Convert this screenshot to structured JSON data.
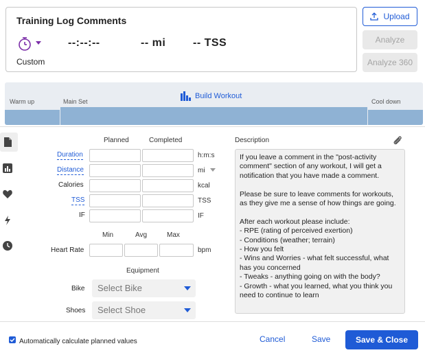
{
  "summary": {
    "title": "Training Log Comments",
    "workout_type": "Custom",
    "duration": "--:--:--",
    "distance": "-- mi",
    "tss": "-- TSS",
    "icon": "stopwatch-icon",
    "accent": "#7b2ea8"
  },
  "actions": {
    "upload_label": "Upload",
    "analyze_label": "Analyze",
    "analyze360_label": "Analyze 360"
  },
  "builder": {
    "build_label": "Build Workout",
    "segments": [
      "Warm up",
      "Main Set",
      "Cool down"
    ],
    "bar_color": "#8fb2d4"
  },
  "rail": {
    "icons": [
      "document-icon",
      "chart-icon",
      "heart-icon",
      "bolt-icon",
      "clock-icon"
    ]
  },
  "planned_completed": {
    "headers": [
      "Planned",
      "Completed"
    ],
    "rows": [
      {
        "label": "Duration",
        "unit": "h:m:s",
        "planned": "",
        "completed": ""
      },
      {
        "label": "Distance",
        "unit": "mi",
        "planned": "",
        "completed": ""
      },
      {
        "label": "Calories",
        "unit": "kcal",
        "planned": "",
        "completed": ""
      },
      {
        "label": "TSS",
        "unit": "TSS",
        "planned": "",
        "completed": ""
      },
      {
        "label": "IF",
        "unit": "IF",
        "planned": "",
        "completed": ""
      }
    ]
  },
  "heart_rate": {
    "headers": [
      "Min",
      "Avg",
      "Max"
    ],
    "label": "Heart Rate",
    "unit": "bpm",
    "min": "",
    "avg": "",
    "max": ""
  },
  "equipment": {
    "heading": "Equipment",
    "bike_label": "Bike",
    "bike_value": "Select Bike",
    "shoes_label": "Shoes",
    "shoes_value": "Select Shoe"
  },
  "description": {
    "label": "Description",
    "text": "If you leave a comment in the \"post-activity comment\" section of any workout, I will get a notification that you have made a comment.\n\nPlease be sure to leave comments for workouts, as they give me a sense of how things are going.\n\nAfter each workout please include:\n- RPE (rating of perceived exertion)\n- Conditions (weather; terrain)\n- How you felt\n- Wins and Worries - what felt successful, what has you concerned\n- Tweaks - anything going on with the body?\n- Growth - what you learned, what you think you need to continue to learn"
  },
  "footer": {
    "auto_calc_label": "Automatically calculate planned values",
    "auto_calc_checked": true,
    "cancel_label": "Cancel",
    "save_label": "Save",
    "save_close_label": "Save & Close"
  }
}
